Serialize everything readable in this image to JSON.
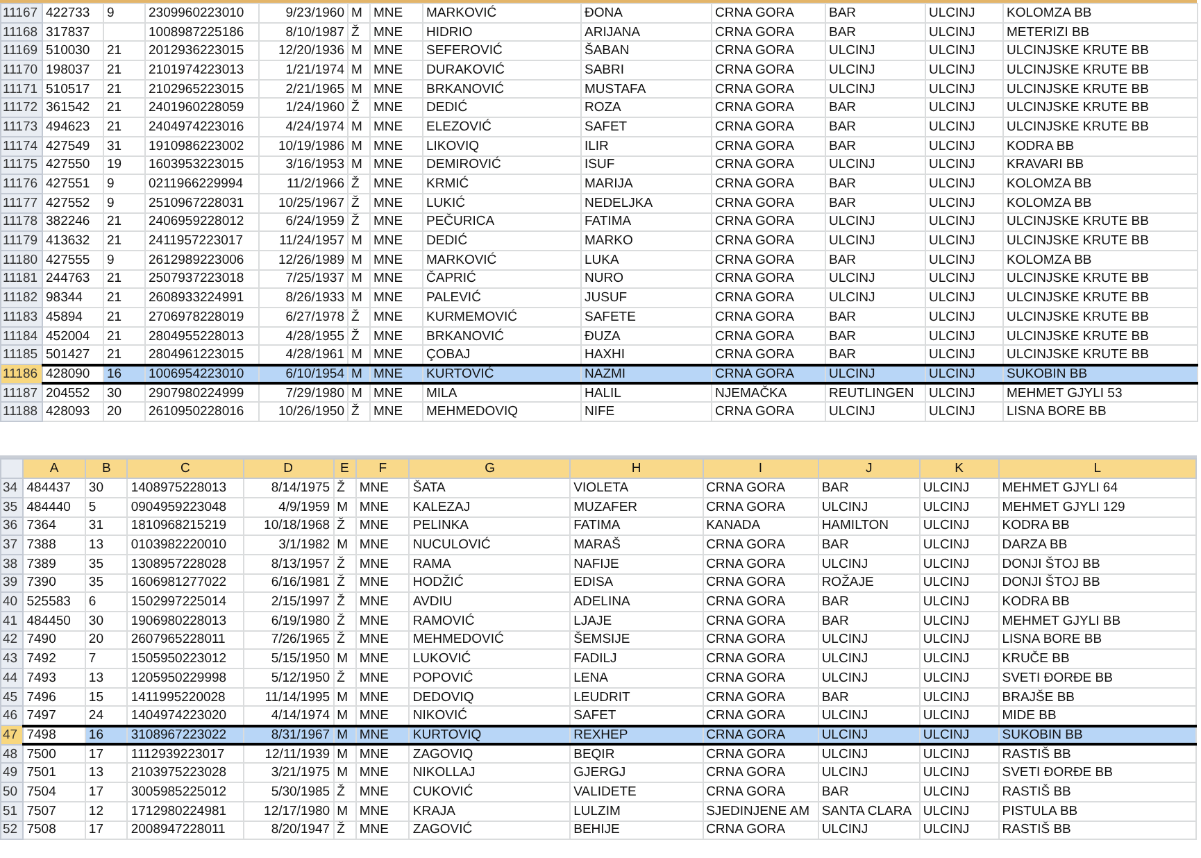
{
  "panes": [
    {
      "rows": [
        {
          "number": "11167",
          "selected": false,
          "cells": [
            "422733",
            "9",
            "2309960223010",
            "9/23/1960",
            "M",
            "MNE",
            "MARKOVIĆ",
            "ĐONA",
            "CRNA GORA",
            "BAR",
            "ULCINJ",
            "KOLOMZA BB"
          ]
        },
        {
          "number": "11168",
          "selected": false,
          "cells": [
            "317837",
            null,
            "1008987225186",
            "8/10/1987",
            "Ž",
            "MNE",
            "HIDRIO",
            "ARIJANA",
            "CRNA GORA",
            "BAR",
            "ULCINJ",
            "METERIZI BB"
          ]
        },
        {
          "number": "11169",
          "selected": false,
          "cells": [
            "510030",
            "21",
            "2012936223015",
            "12/20/1936",
            "M",
            "MNE",
            "SEFEROVIĆ",
            "ŠABAN",
            "CRNA GORA",
            "ULCINJ",
            "ULCINJ",
            "ULCINJSKE KRUTE BB"
          ]
        },
        {
          "number": "11170",
          "selected": false,
          "cells": [
            "198037",
            "21",
            "2101974223013",
            "1/21/1974",
            "M",
            "MNE",
            "DURAKOVIĆ",
            "SABRI",
            "CRNA GORA",
            "ULCINJ",
            "ULCINJ",
            "ULCINJSKE KRUTE BB"
          ]
        },
        {
          "number": "11171",
          "selected": false,
          "cells": [
            "510517",
            "21",
            "2102965223015",
            "2/21/1965",
            "M",
            "MNE",
            "BRKANOVIĆ",
            "MUSTAFA",
            "CRNA GORA",
            "ULCINJ",
            "ULCINJ",
            "ULCINJSKE KRUTE BB"
          ]
        },
        {
          "number": "11172",
          "selected": false,
          "cells": [
            "361542",
            "21",
            "2401960228059",
            "1/24/1960",
            "Ž",
            "MNE",
            "DEDIĆ",
            "ROZA",
            "CRNA GORA",
            "BAR",
            "ULCINJ",
            "ULCINJSKE KRUTE BB"
          ]
        },
        {
          "number": "11173",
          "selected": false,
          "cells": [
            "494623",
            "21",
            "2404974223016",
            "4/24/1974",
            "M",
            "MNE",
            "ELEZOVIĆ",
            "SAFET",
            "CRNA GORA",
            "BAR",
            "ULCINJ",
            "ULCINJSKE KRUTE BB"
          ]
        },
        {
          "number": "11174",
          "selected": false,
          "cells": [
            "427549",
            "31",
            "1910986223002",
            "10/19/1986",
            "M",
            "MNE",
            "LIKOVIQ",
            "ILIR",
            "CRNA GORA",
            "BAR",
            "ULCINJ",
            "KODRA BB"
          ]
        },
        {
          "number": "11175",
          "selected": false,
          "cells": [
            "427550",
            "19",
            "1603953223015",
            "3/16/1953",
            "M",
            "MNE",
            "DEMIROVIĆ",
            "ISUF",
            "CRNA GORA",
            "ULCINJ",
            "ULCINJ",
            "KRAVARI BB"
          ]
        },
        {
          "number": "11176",
          "selected": false,
          "cells": [
            "427551",
            "9",
            "0211966229994",
            "11/2/1966",
            "Ž",
            "MNE",
            "KRMIĆ",
            "MARIJA",
            "CRNA GORA",
            "BAR",
            "ULCINJ",
            "KOLOMZA BB"
          ]
        },
        {
          "number": "11177",
          "selected": false,
          "cells": [
            "427552",
            "9",
            "2510967228031",
            "10/25/1967",
            "Ž",
            "MNE",
            "LUKIĆ",
            "NEDELJKA",
            "CRNA GORA",
            "BAR",
            "ULCINJ",
            "KOLOMZA BB"
          ]
        },
        {
          "number": "11178",
          "selected": false,
          "cells": [
            "382246",
            "21",
            "2406959228012",
            "6/24/1959",
            "Ž",
            "MNE",
            "PEČURICA",
            "FATIMA",
            "CRNA GORA",
            "ULCINJ",
            "ULCINJ",
            "ULCINJSKE KRUTE BB"
          ]
        },
        {
          "number": "11179",
          "selected": false,
          "cells": [
            "413632",
            "21",
            "2411957223017",
            "11/24/1957",
            "M",
            "MNE",
            "DEDIĆ",
            "MARKO",
            "CRNA GORA",
            "ULCINJ",
            "ULCINJ",
            "ULCINJSKE KRUTE BB"
          ]
        },
        {
          "number": "11180",
          "selected": false,
          "cells": [
            "427555",
            "9",
            "2612989223006",
            "12/26/1989",
            "M",
            "MNE",
            "MARKOVIĆ",
            "LUKA",
            "CRNA GORA",
            "BAR",
            "ULCINJ",
            "KOLOMZA BB"
          ]
        },
        {
          "number": "11181",
          "selected": false,
          "cells": [
            "244763",
            "21",
            "2507937223018",
            "7/25/1937",
            "M",
            "MNE",
            "ČAPRIĆ",
            "NURO",
            "CRNA GORA",
            "ULCINJ",
            "ULCINJ",
            "ULCINJSKE KRUTE BB"
          ]
        },
        {
          "number": "11182",
          "selected": false,
          "cells": [
            "98344",
            "21",
            "2608933224991",
            "8/26/1933",
            "M",
            "MNE",
            "PALEVIĆ",
            "JUSUF",
            "CRNA GORA",
            "ULCINJ",
            "ULCINJ",
            "ULCINJSKE KRUTE BB"
          ]
        },
        {
          "number": "11183",
          "selected": false,
          "cells": [
            "45894",
            "21",
            "2706978228019",
            "6/27/1978",
            "Ž",
            "MNE",
            "KURMEMOVIĆ",
            "SAFETE",
            "CRNA GORA",
            "BAR",
            "ULCINJ",
            "ULCINJSKE KRUTE BB"
          ]
        },
        {
          "number": "11184",
          "selected": false,
          "cells": [
            "452004",
            "21",
            "2804955228013",
            "4/28/1955",
            "Ž",
            "MNE",
            "BRKANOVIĆ",
            "ĐUZA",
            "CRNA GORA",
            "BAR",
            "ULCINJ",
            "ULCINJSKE KRUTE BB"
          ]
        },
        {
          "number": "11185",
          "selected": false,
          "cells": [
            "501427",
            "21",
            "2804961223015",
            "4/28/1961",
            "M",
            "MNE",
            "ÇOBAJ",
            "HAXHI",
            "CRNA GORA",
            "BAR",
            "ULCINJ",
            "ULCINJSKE KRUTE BB"
          ]
        },
        {
          "number": "11186",
          "selected": true,
          "cells": [
            "428090",
            "16",
            "1006954223010",
            "6/10/1954",
            "M",
            "MNE",
            "KURTOVIĆ",
            "NAZMI",
            "CRNA GORA",
            "ULCINJ",
            "ULCINJ",
            "SUKOBIN BB"
          ]
        },
        {
          "number": "11187",
          "selected": false,
          "cells": [
            "204552",
            "30",
            "2907980224999",
            "7/29/1980",
            "M",
            "MNE",
            "MILA",
            "HALIL",
            "NJEMAČKA",
            "REUTLINGEN",
            "ULCINJ",
            "MEHMET GJYLI 53"
          ]
        },
        {
          "number": "11188",
          "selected": false,
          "cells": [
            "428093",
            "20",
            "2610950228016",
            "10/26/1950",
            "Ž",
            "MNE",
            "MEHMEDOVIQ",
            "NIFE",
            "CRNA GORA",
            "ULCINJ",
            "ULCINJ",
            "LISNA BORE BB"
          ]
        }
      ]
    },
    {
      "column_headers": [
        {
          "label": "A",
          "selected": true
        },
        {
          "label": "B",
          "selected": true
        },
        {
          "label": "C",
          "selected": true
        },
        {
          "label": "D",
          "selected": true
        },
        {
          "label": "E",
          "selected": true
        },
        {
          "label": "F",
          "selected": true
        },
        {
          "label": "G",
          "selected": true
        },
        {
          "label": "H",
          "selected": true
        },
        {
          "label": "I",
          "selected": true
        },
        {
          "label": "J",
          "selected": true
        },
        {
          "label": "K",
          "selected": true
        },
        {
          "label": "L",
          "selected": true
        }
      ],
      "rows": [
        {
          "number": "34",
          "selected": false,
          "cells": [
            "484437",
            "30",
            "1408975228013",
            "8/14/1975",
            "Ž",
            "MNE",
            "ŠATA",
            "VIOLETA",
            "CRNA GORA",
            "BAR",
            "ULCINJ",
            "MEHMET GJYLI 64"
          ]
        },
        {
          "number": "35",
          "selected": false,
          "cells": [
            "484440",
            "5",
            "0904959223048",
            "4/9/1959",
            "M",
            "MNE",
            "KALEZAJ",
            "MUZAFER",
            "CRNA GORA",
            "ULCINJ",
            "ULCINJ",
            "MEHMET GJYLI 129"
          ]
        },
        {
          "number": "36",
          "selected": false,
          "cells": [
            "7364",
            "31",
            "1810968215219",
            "10/18/1968",
            "Ž",
            "MNE",
            "PELINKA",
            "FATIMA",
            "KANADA",
            "HAMILTON",
            "ULCINJ",
            "KODRA BB"
          ]
        },
        {
          "number": "37",
          "selected": false,
          "cells": [
            "7388",
            "13",
            "0103982220010",
            "3/1/1982",
            "M",
            "MNE",
            "NUCULOVIĆ",
            "MARAŠ",
            "CRNA GORA",
            "BAR",
            "ULCINJ",
            "DARZA BB"
          ]
        },
        {
          "number": "38",
          "selected": false,
          "cells": [
            "7389",
            "35",
            "1308957228028",
            "8/13/1957",
            "Ž",
            "MNE",
            "RAMA",
            "NAFIJE",
            "CRNA GORA",
            "ULCINJ",
            "ULCINJ",
            "DONJI ŠTOJ BB"
          ]
        },
        {
          "number": "39",
          "selected": false,
          "cells": [
            "7390",
            "35",
            "1606981277022",
            "6/16/1981",
            "Ž",
            "MNE",
            "HODŽIĆ",
            "EDISA",
            "CRNA GORA",
            "ROŽAJE",
            "ULCINJ",
            "DONJI ŠTOJ BB"
          ]
        },
        {
          "number": "40",
          "selected": false,
          "cells": [
            "525583",
            "6",
            "1502997225014",
            "2/15/1997",
            "Ž",
            "MNE",
            "AVDIU",
            "ADELINA",
            "CRNA GORA",
            "BAR",
            "ULCINJ",
            "KODRA BB"
          ]
        },
        {
          "number": "41",
          "selected": false,
          "cells": [
            "484450",
            "30",
            "1906980228013",
            "6/19/1980",
            "Ž",
            "MNE",
            "RAMOVIĆ",
            "LJAJE",
            "CRNA GORA",
            "BAR",
            "ULCINJ",
            "MEHMET GJYLI BB"
          ]
        },
        {
          "number": "42",
          "selected": false,
          "cells": [
            "7490",
            "20",
            "2607965228011",
            "7/26/1965",
            "Ž",
            "MNE",
            "MEHMEDOVIĆ",
            "ŠEMSIJE",
            "CRNA GORA",
            "ULCINJ",
            "ULCINJ",
            "LISNA BORE BB"
          ]
        },
        {
          "number": "43",
          "selected": false,
          "cells": [
            "7492",
            "7",
            "1505950223012",
            "5/15/1950",
            "M",
            "MNE",
            "LUKOVIĆ",
            "FADILJ",
            "CRNA GORA",
            "ULCINJ",
            "ULCINJ",
            "KRUČE BB"
          ]
        },
        {
          "number": "44",
          "selected": false,
          "cells": [
            "7493",
            "13",
            "1205950229998",
            "5/12/1950",
            "Ž",
            "MNE",
            "POPOVIĆ",
            "LENA",
            "CRNA GORA",
            "ULCINJ",
            "ULCINJ",
            "SVETI ĐORĐE BB"
          ]
        },
        {
          "number": "45",
          "selected": false,
          "cells": [
            "7496",
            "15",
            "1411995220028",
            "11/14/1995",
            "M",
            "MNE",
            "DEDOVIQ",
            "LEUDRIT",
            "CRNA GORA",
            "BAR",
            "ULCINJ",
            "BRAJŠE BB"
          ]
        },
        {
          "number": "46",
          "selected": false,
          "cells": [
            "7497",
            "24",
            "1404974223020",
            "4/14/1974",
            "M",
            "MNE",
            "NIKOVIĆ",
            "SAFET",
            "CRNA GORA",
            "ULCINJ",
            "ULCINJ",
            "MIDE BB"
          ]
        },
        {
          "number": "47",
          "selected": true,
          "cells": [
            "7498",
            "16",
            "3108967223022",
            "8/31/1967",
            "M",
            "MNE",
            "KURTOVIQ",
            "REXHEP",
            "CRNA GORA",
            "ULCINJ",
            "ULCINJ",
            "SUKOBIN BB"
          ]
        },
        {
          "number": "48",
          "selected": false,
          "cells": [
            "7500",
            "17",
            "1112939223017",
            "12/11/1939",
            "M",
            "MNE",
            "ZAGOVIQ",
            "BEQIR",
            "CRNA GORA",
            "ULCINJ",
            "ULCINJ",
            "RASTIŠ BB"
          ]
        },
        {
          "number": "49",
          "selected": false,
          "cells": [
            "7501",
            "13",
            "2103975223028",
            "3/21/1975",
            "M",
            "MNE",
            "NIKOLLAJ",
            "GJERGJ",
            "CRNA GORA",
            "ULCINJ",
            "ULCINJ",
            "SVETI ĐORĐE BB"
          ]
        },
        {
          "number": "50",
          "selected": false,
          "cells": [
            "7504",
            "17",
            "3005985225012",
            "5/30/1985",
            "Ž",
            "MNE",
            "CUKOVIĆ",
            "VALIDETE",
            "CRNA GORA",
            "BAR",
            "ULCINJ",
            "RASTIŠ BB"
          ]
        },
        {
          "number": "51",
          "selected": false,
          "cells": [
            "7507",
            "12",
            "1712980224981",
            "12/17/1980",
            "M",
            "MNE",
            "KRAJA",
            "LULZIM",
            "SJEDINJENE AM",
            "SANTA CLARA",
            "ULCINJ",
            "PISTULA BB"
          ]
        },
        {
          "number": "52",
          "selected": false,
          "cells": [
            "7508",
            "17",
            "2008947228011",
            "8/20/1947",
            "Ž",
            "MNE",
            "ZAGOVIĆ",
            "BEHIJE",
            "CRNA GORA",
            "ULCINJ",
            "ULCINJ",
            "RASTIŠ BB"
          ]
        }
      ]
    }
  ]
}
